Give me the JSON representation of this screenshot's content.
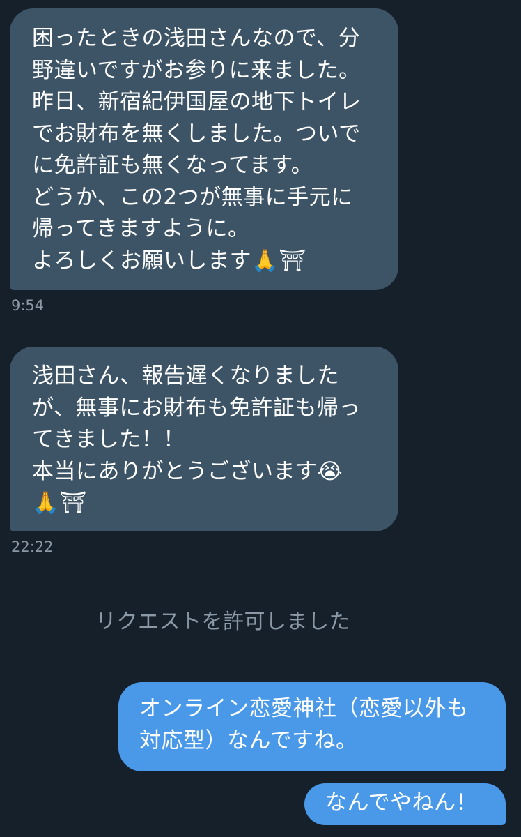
{
  "messages": [
    {
      "direction": "received",
      "text": "困ったときの浅田さんなので、分\n野違いですがお参りに来ました。\n昨日、新宿紀伊国屋の地下トイレ\nでお財布を無くしました。ついで\nに免許証も無くなってます。\nどうか、この2つが無事に手元に\n帰ってきますように。\nよろしくお願いします🙏⛩",
      "time": "9:54"
    },
    {
      "direction": "received",
      "text": "浅田さん、報告遅くなりました\nが、無事にお財布も免許証も帰っ\nてきました！！\n本当にありがとうございます😭\n🙏⛩",
      "time": "22:22"
    },
    {
      "direction": "sent",
      "text": "オンライン恋愛神社（恋愛以外も\n対応型）なんですね。"
    },
    {
      "direction": "sent",
      "text": "なんでやねん！"
    }
  ],
  "system_notice": "リクエストを許可しました",
  "colors": {
    "background": "#15202b",
    "received_bubble": "#3d5466",
    "sent_bubble": "#4a99e9",
    "timestamp": "#8b98a5"
  }
}
